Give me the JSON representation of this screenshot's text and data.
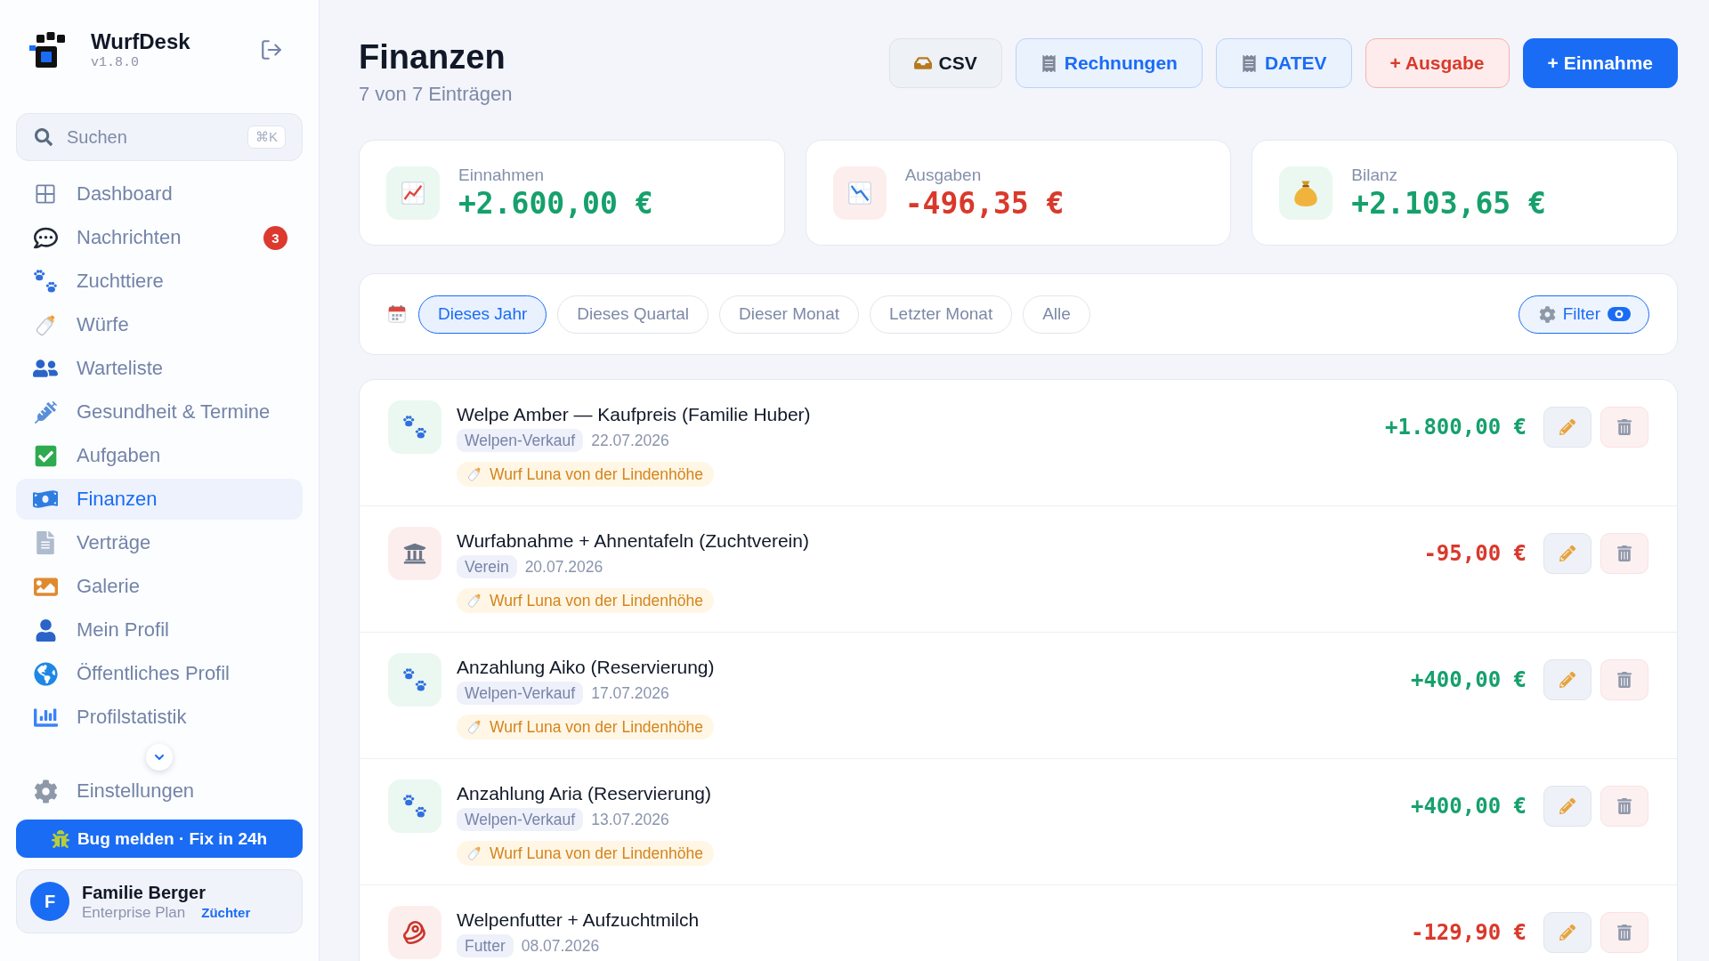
{
  "sidebar": {
    "brand": {
      "name": "WurfDesk",
      "version": "v1.8.0"
    },
    "search": {
      "placeholder": "Suchen",
      "shortcut": "⌘K"
    },
    "nav": [
      {
        "label": "Dashboard",
        "selected": false
      },
      {
        "label": "Nachrichten",
        "selected": false,
        "badge": "3"
      },
      {
        "label": "Zuchttiere",
        "selected": false
      },
      {
        "label": "Würfe",
        "selected": false
      },
      {
        "label": "Warteliste",
        "selected": false
      },
      {
        "label": "Gesundheit & Termine",
        "selected": false
      },
      {
        "label": "Aufgaben",
        "selected": false
      },
      {
        "label": "Finanzen",
        "selected": true
      },
      {
        "label": "Verträge",
        "selected": false
      },
      {
        "label": "Galerie",
        "selected": false
      },
      {
        "label": "Mein Profil",
        "selected": false
      },
      {
        "label": "Öffentliches Profil",
        "selected": false
      },
      {
        "label": "Profilstatistik",
        "selected": false
      }
    ],
    "settings_item": {
      "label": "Einstellungen",
      "selected": false
    },
    "bug_button": {
      "label": "Bug melden · Fix in 24h"
    },
    "user": {
      "initial": "F",
      "name": "Familie Berger",
      "plan": "Enterprise Plan",
      "role": "Züchter"
    }
  },
  "header": {
    "title": "Finanzen",
    "subtitle": "7 von 7 Einträgen",
    "actions": [
      {
        "label": "CSV",
        "kind": "neutral"
      },
      {
        "label": "Rechnungen",
        "kind": "info"
      },
      {
        "label": "DATEV",
        "kind": "info"
      },
      {
        "label": "+ Ausgabe",
        "kind": "danger"
      },
      {
        "label": "+ Einnahme",
        "kind": "primary"
      }
    ]
  },
  "stats": [
    {
      "label": "Einnahmen",
      "value": "+2.600,00 €",
      "kind": "positive"
    },
    {
      "label": "Ausgaben",
      "value": "-496,35 €",
      "kind": "negative"
    },
    {
      "label": "Bilanz",
      "value": "+2.103,65 €",
      "kind": "positive"
    }
  ],
  "period_filter": {
    "options": [
      {
        "label": "Dieses Jahr",
        "selected": true
      },
      {
        "label": "Dieses Quartal",
        "selected": false
      },
      {
        "label": "Dieser Monat",
        "selected": false
      },
      {
        "label": "Letzter Monat",
        "selected": false
      },
      {
        "label": "Alle",
        "selected": false
      }
    ],
    "filter_button": {
      "label": "Filter"
    }
  },
  "entries": [
    {
      "title": "Welpe Amber — Kaufpreis (Familie Huber)",
      "category": "Welpen-Verkauf",
      "date": "22.07.2026",
      "litter": "Wurf Luna von der Lindenhöhe",
      "amount": "+1.800,00 €",
      "kind": "income"
    },
    {
      "title": "Wurfabnahme + Ahnentafeln (Zuchtverein)",
      "category": "Verein",
      "date": "20.07.2026",
      "litter": "Wurf Luna von der Lindenhöhe",
      "amount": "-95,00 €",
      "kind": "expense"
    },
    {
      "title": "Anzahlung Aiko (Reservierung)",
      "category": "Welpen-Verkauf",
      "date": "17.07.2026",
      "litter": "Wurf Luna von der Lindenhöhe",
      "amount": "+400,00 €",
      "kind": "income"
    },
    {
      "title": "Anzahlung Aria (Reservierung)",
      "category": "Welpen-Verkauf",
      "date": "13.07.2026",
      "litter": "Wurf Luna von der Lindenhöhe",
      "amount": "+400,00 €",
      "kind": "income"
    },
    {
      "title": "Welpenfutter + Aufzuchtmilch",
      "category": "Futter",
      "date": "08.07.2026",
      "amount": "-129,90 €",
      "kind": "expense"
    }
  ]
}
